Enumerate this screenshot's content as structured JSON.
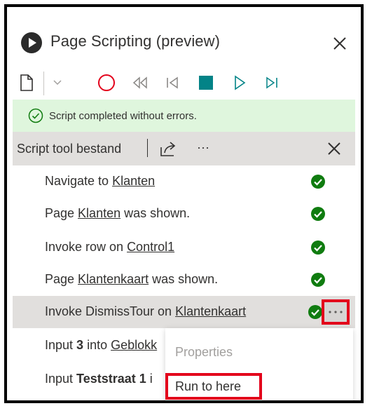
{
  "header": {
    "title": "Page Scripting (preview)"
  },
  "toolbar": {
    "icons": [
      "new-file-icon",
      "chevron-down-icon",
      "record-icon",
      "rewind-icon",
      "step-back-icon",
      "stop-icon",
      "play-icon",
      "step-forward-icon"
    ]
  },
  "status": {
    "text": "Script completed without errors."
  },
  "list": {
    "file_name": "Script tool bestand",
    "more": "···"
  },
  "steps": [
    {
      "pre": "Navigate to ",
      "link": "Klanten",
      "post": ""
    },
    {
      "pre": "Page ",
      "link": "Klanten",
      "post": " was shown."
    },
    {
      "pre": "Invoke row on ",
      "link": "Control1",
      "post": ""
    },
    {
      "pre": "Page ",
      "link": "Klantenkaart",
      "post": " was shown."
    },
    {
      "pre": "Invoke DismissTour on ",
      "link": "Klantenkaart",
      "post": ""
    },
    {
      "pre": "Input ",
      "bold": "3",
      "mid": " into ",
      "link": "Geblokk"
    },
    {
      "pre": "Input ",
      "bold": "Teststraat 1",
      "mid": " i"
    }
  ],
  "context_menu": {
    "properties": "Properties",
    "run_to_here": "Run to here"
  },
  "colors": {
    "success": "#107c10",
    "highlight": "#e3001b",
    "status_bg": "#dff6dd",
    "record": "#e3001b",
    "accent": "#038387"
  }
}
